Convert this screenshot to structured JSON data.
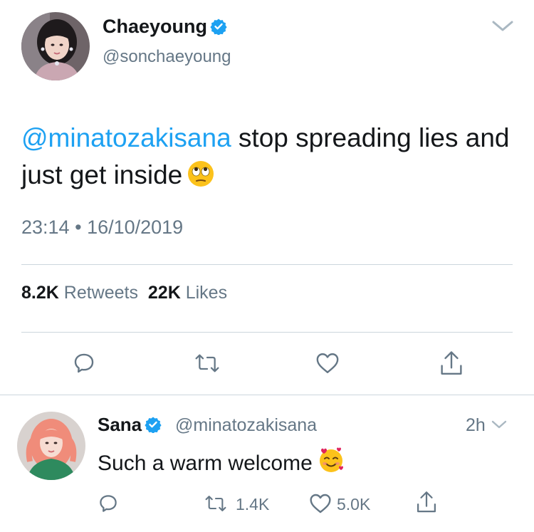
{
  "tweet": {
    "author_name": "Chaeyoung",
    "author_handle": "@sonchaeyoung",
    "mention": "@minatozakisana",
    "text_after_mention": " stop spreading lies and just get inside",
    "emoji": "face-with-rolling-eyes",
    "time": "23:14",
    "separator": "•",
    "date": "16/10/2019",
    "retweets_count": "8.2K",
    "retweets_label": "Retweets",
    "likes_count": "22K",
    "likes_label": "Likes"
  },
  "reply": {
    "author_name": "Sana",
    "author_handle": "@minatozakisana",
    "time_ago": "2h",
    "text": "Such a warm welcome",
    "emoji": "smiling-face-with-hearts",
    "retweets_count": "1.4K",
    "likes_count": "5.0K"
  },
  "icons": {
    "verified": "verified-badge-icon",
    "reply": "reply-icon",
    "retweet": "retweet-icon",
    "like": "heart-icon",
    "share": "share-icon",
    "menu": "chevron-down-icon"
  },
  "colors": {
    "accent": "#1da1f2",
    "text": "#14171a",
    "secondary": "#657786",
    "divider": "#ccd6dd"
  }
}
